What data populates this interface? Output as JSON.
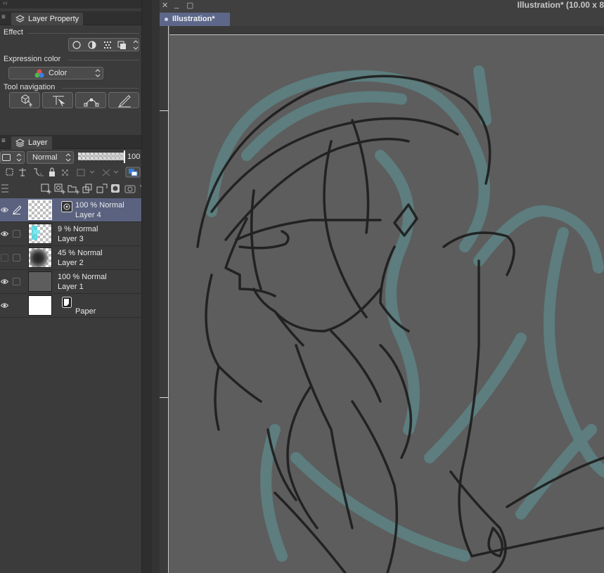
{
  "panels": {
    "layer_property": {
      "tab_label": "Layer Property",
      "effect_label": "Effect",
      "expression_color_label": "Expression color",
      "expression_color_value": "Color",
      "tool_navigation_label": "Tool navigation"
    },
    "layer": {
      "tab_label": "Layer",
      "blend_mode": "Normal",
      "opacity": "100",
      "opacity_fraction": 1.0,
      "layers": [
        {
          "opacity_mode": "100 % Normal",
          "name": "Layer 4",
          "visible": true,
          "selected": true,
          "thumb": "transparent"
        },
        {
          "opacity_mode": "9 % Normal",
          "name": "Layer 3",
          "visible": true,
          "selected": false,
          "thumb": "cyan"
        },
        {
          "opacity_mode": "45 % Normal",
          "name": "Layer 2",
          "visible": false,
          "selected": false,
          "thumb": "dark"
        },
        {
          "opacity_mode": "100 % Normal",
          "name": "Layer 1",
          "visible": true,
          "selected": false,
          "thumb": "gray"
        },
        {
          "opacity_mode": "",
          "name": "Paper",
          "visible": true,
          "selected": false,
          "thumb": "white"
        }
      ]
    }
  },
  "document": {
    "title": "Illustration* (10.00 x 8",
    "tab_label": "Illustration*"
  },
  "colors": {
    "selected_row": "#5a6280",
    "doc_tab": "#5d6789",
    "canvas": "#5d5d5d",
    "underpaint": "#5e7f80"
  }
}
